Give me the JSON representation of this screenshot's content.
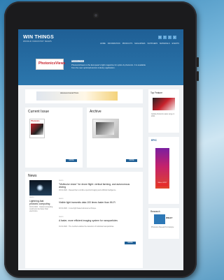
{
  "site": {
    "logo": "WIN THINGS",
    "logo_sub": "WORLD INDUSTRY NEWS",
    "socials": [
      "in",
      "f",
      "t",
      "y"
    ],
    "nav": [
      "HOME",
      "INFORMATION",
      "PRODUCTS",
      "MAGAZINES",
      "SUPPLIERS",
      "MATERIALS",
      "EVENTS"
    ]
  },
  "banner": {
    "magazine_logo": "PhotonicsViews",
    "tag": "Photonics Views",
    "text": "PhotonicsViews is the European's light magazine for optics & photonics. It is available from the new optics/photonics industry application."
  },
  "ad": {
    "text": "Advanced Aerial Photo"
  },
  "current_issue": {
    "title": "Current Issue",
    "cover_label": "Photonics",
    "more": "MORE"
  },
  "archive": {
    "title": "Archive",
    "more": "MORE"
  },
  "news": {
    "title": "News",
    "items": [
      {
        "tag": "NEWS",
        "headline": "Lightning-fast photonic computing",
        "snippet": "04.01.2024 · Optical computing could soon be faster than electronics."
      },
      {
        "tag": "NEWS",
        "headline": "\"Multicolor vision\" for drone flight: vertical farming, and autonomous driving",
        "snippet": "03.01.2024 · Researchers combine spectral imaging and artificial intelligence."
      },
      {
        "tag": "NEWS",
        "headline": "Visible light transmits data 100 times faster than Wi-Fi",
        "snippet": "02.01.2024 · A new light based wireless technique."
      },
      {
        "tag": "NEWS",
        "headline": "A faster, more efficient imaging system for nanoparticles",
        "snippet": "01.01.2024 · The method enables the detection of individual nanoparticles."
      }
    ],
    "more": "MORE"
  },
  "sidebar": {
    "top_feature": "Top Feature",
    "feature_text": "Global photonics sales surge in 2024",
    "epic": "EPIC",
    "make_it": "Make it EPIC",
    "research": "Research",
    "wiley": "WILEY",
    "research_text": "Photonics Research in Europe"
  }
}
